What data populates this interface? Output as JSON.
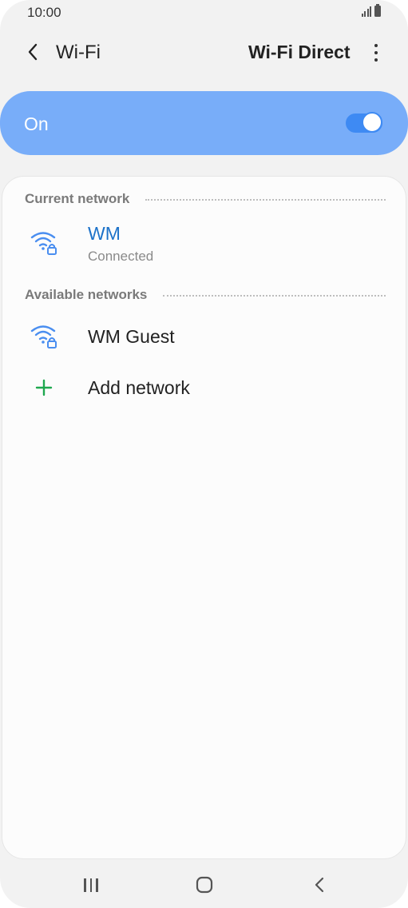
{
  "status_bar": {
    "time": "10:00"
  },
  "header": {
    "title": "Wi-Fi",
    "wifi_direct": "Wi-Fi Direct"
  },
  "master_switch": {
    "label": "On",
    "state": true
  },
  "sections": {
    "current": {
      "title": "Current network"
    },
    "available": {
      "title": "Available networks"
    }
  },
  "current_network": {
    "name": "WM",
    "status": "Connected"
  },
  "available_networks": [
    {
      "name": "WM Guest"
    }
  ],
  "add_network": {
    "label": "Add network"
  },
  "colors": {
    "accent": "#3e8af3",
    "switch_bar": "#78adf9",
    "connected_text": "#1d72c9",
    "wifi_icon": "#4a8ef0",
    "plus_icon": "#1fa84f"
  }
}
